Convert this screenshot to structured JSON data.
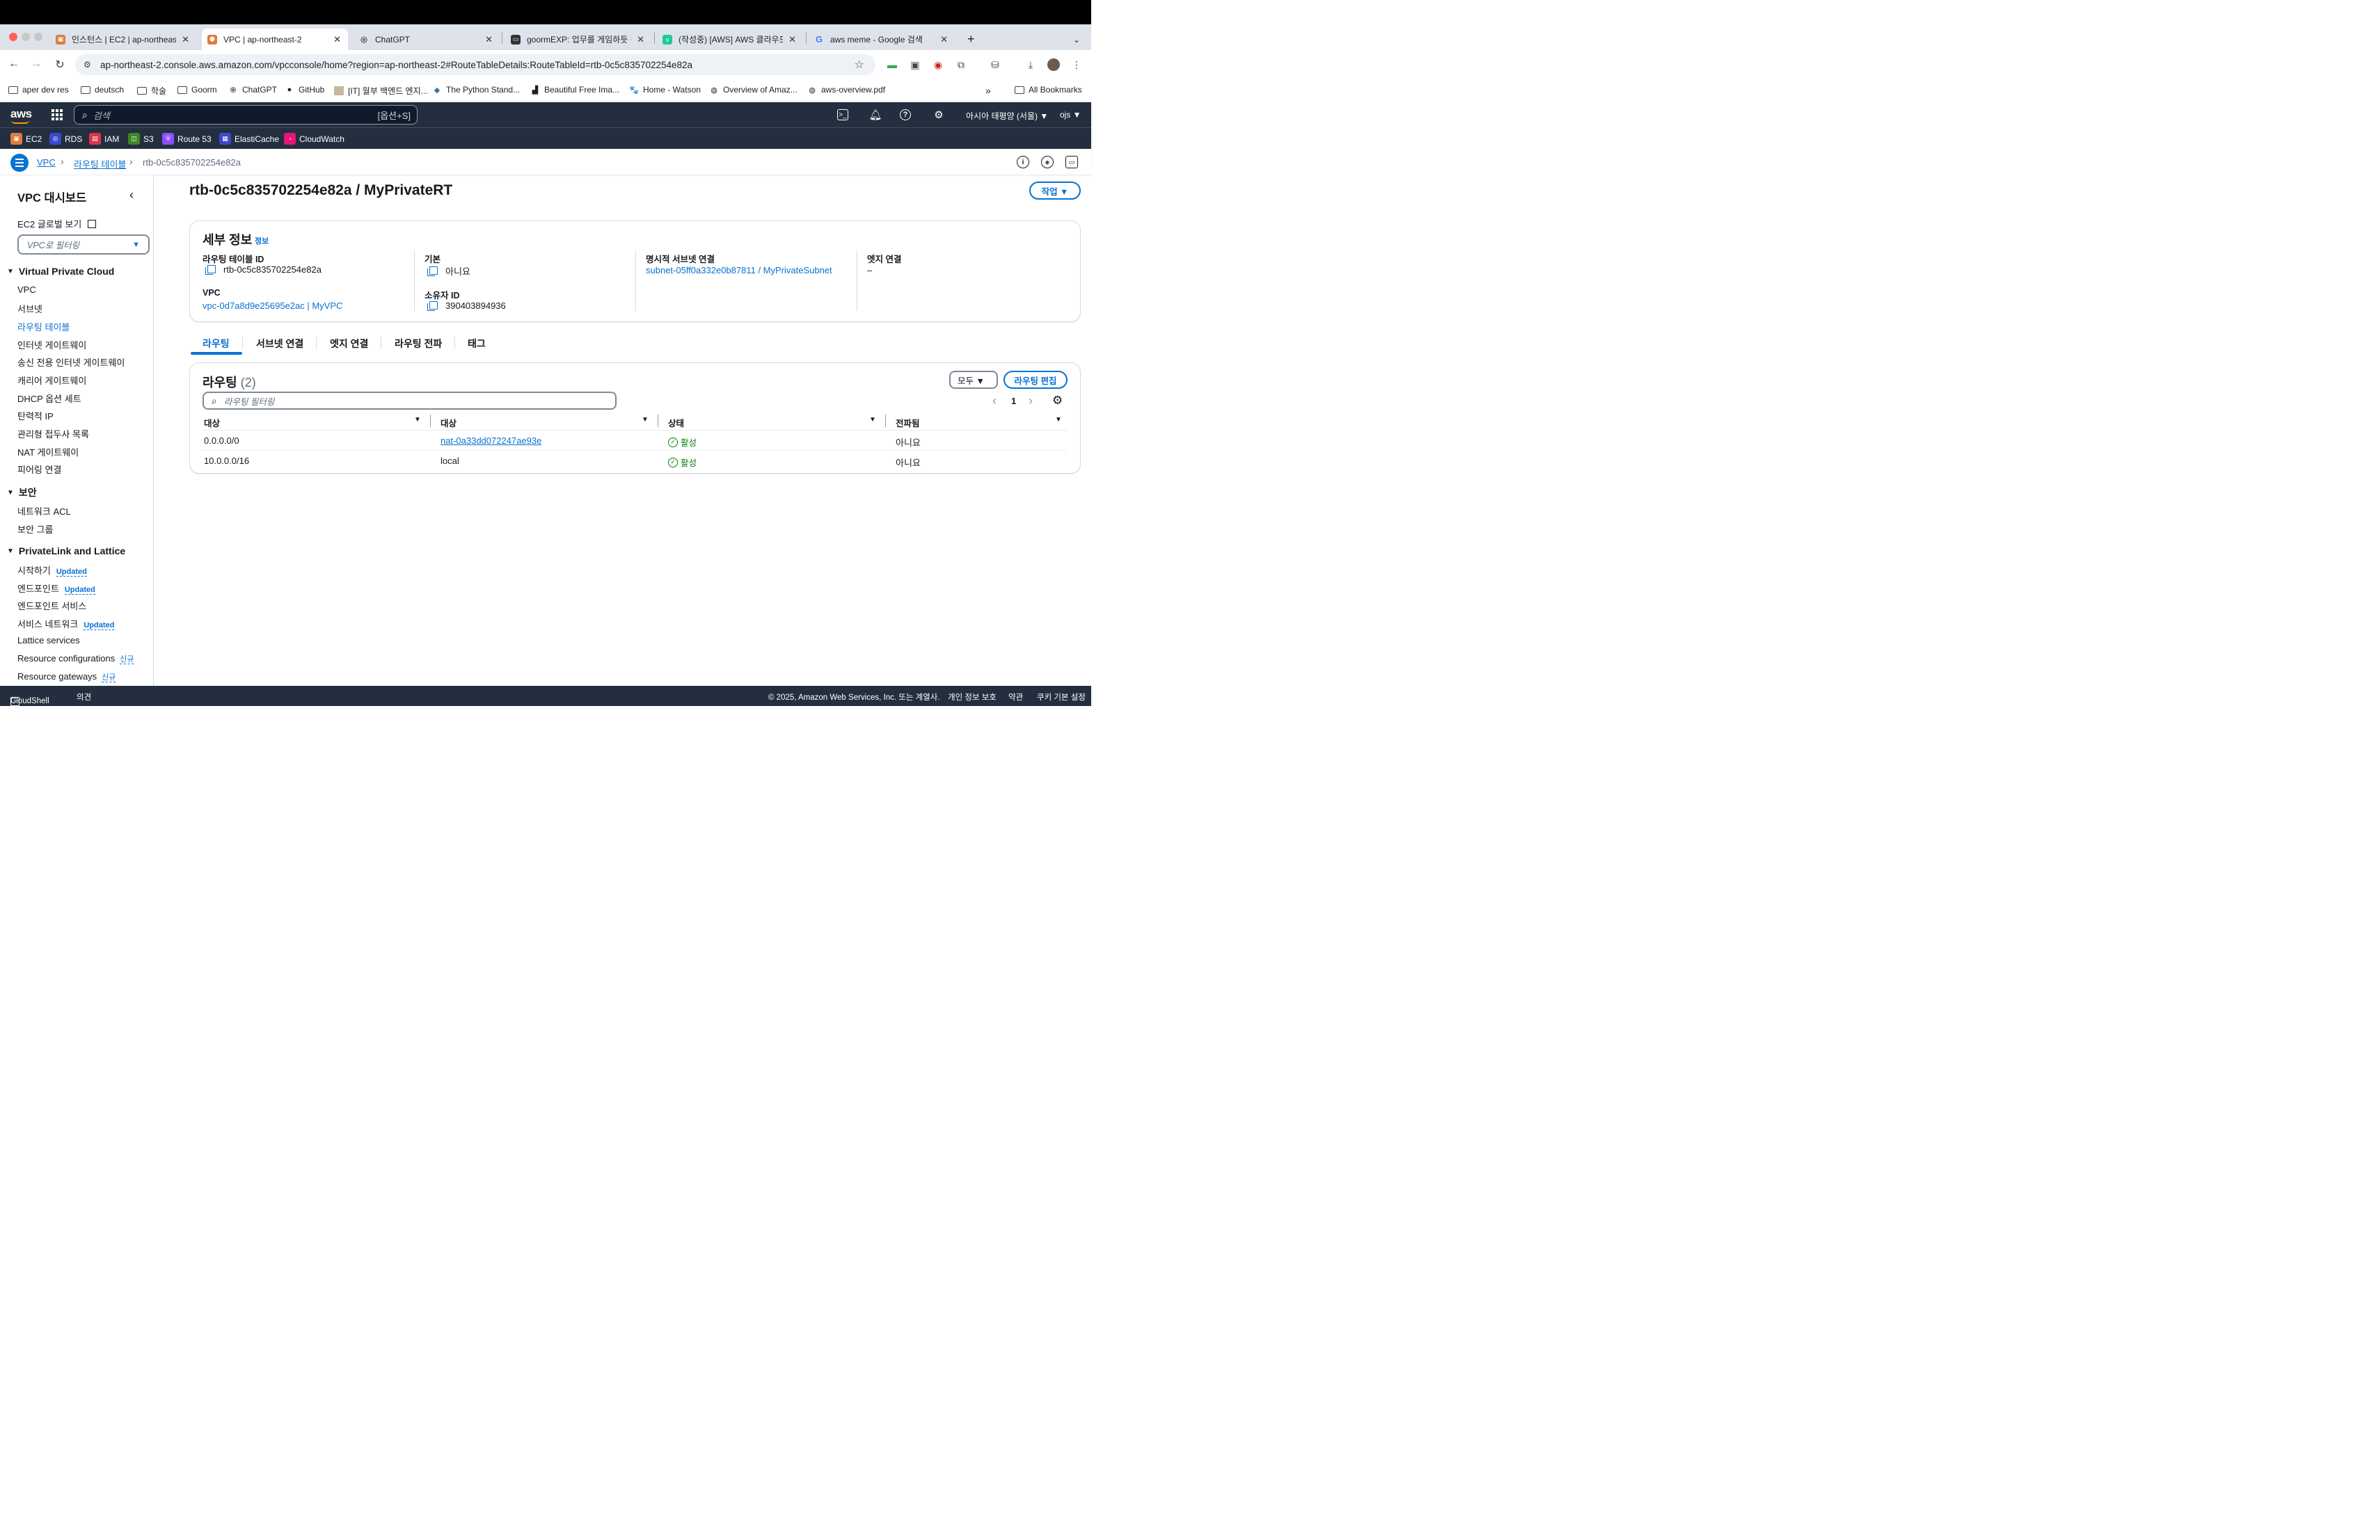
{
  "browser": {
    "tabs": [
      {
        "title": "인스턴스 | EC2 | ap-northeast-2",
        "favicon": "ec2-icon",
        "color": "#e07b39"
      },
      {
        "title": "VPC | ap-northeast-2",
        "favicon": "vpc-icon",
        "color": "#e07b39"
      },
      {
        "title": "ChatGPT",
        "favicon": "chatgpt-icon",
        "color": "#444444"
      },
      {
        "title": "goormEXP: 업무를 게임하듯 관리",
        "favicon": "goorm-icon",
        "color": "#333333"
      },
      {
        "title": "(작성중) [AWS] AWS 클라우드 네",
        "favicon": "velog-icon",
        "color": "#20c997"
      },
      {
        "title": "aws meme - Google 검색",
        "favicon": "google-icon",
        "color": "#4285f4"
      }
    ],
    "new_tab": "+",
    "url": "ap-northeast-2.console.aws.amazon.com/vpcconsole/home?region=ap-northeast-2#RouteTableDetails:RouteTableId=rtb-0c5c835702254e82a",
    "bookmarks": [
      {
        "label": "aper dev res",
        "icon": "folder-icon"
      },
      {
        "label": "deutsch",
        "icon": "folder-icon"
      },
      {
        "label": "학술",
        "icon": "folder-icon"
      },
      {
        "label": "Goorm",
        "icon": "folder-icon"
      },
      {
        "label": "ChatGPT",
        "icon": "chatgpt-icon"
      },
      {
        "label": "GitHub",
        "icon": "github-icon"
      },
      {
        "label": "[IT] 월부 백엔드 엔지...",
        "icon": "page-icon"
      },
      {
        "label": "The Python Stand...",
        "icon": "python-icon"
      },
      {
        "label": "Beautiful Free Ima...",
        "icon": "unsplash-icon"
      },
      {
        "label": "Home - Watson",
        "icon": "watson-icon"
      },
      {
        "label": "Overview of Amaz...",
        "icon": "globe-icon"
      },
      {
        "label": "aws-overview.pdf",
        "icon": "globe-icon"
      }
    ],
    "more_bookmarks": "»",
    "all_bookmarks": "All Bookmarks"
  },
  "aws": {
    "logo": "aws",
    "search_placeholder": "검색",
    "search_shortcut": "[옵션+S]",
    "region": "아시아 태평양 (서울) ▼",
    "user": "ojs ▼",
    "services": [
      {
        "label": "EC2",
        "color": "#e07b39"
      },
      {
        "label": "RDS",
        "color": "#3b48cc"
      },
      {
        "label": "IAM",
        "color": "#dd344c"
      },
      {
        "label": "S3",
        "color": "#3f8624"
      },
      {
        "label": "Route 53",
        "color": "#8c4fff"
      },
      {
        "label": "ElastiCache",
        "color": "#3b48cc"
      },
      {
        "label": "CloudWatch",
        "color": "#e7157b"
      }
    ]
  },
  "breadcrumb": {
    "items": [
      "VPC",
      "라우팅 테이블",
      "rtb-0c5c835702254e82a"
    ]
  },
  "sidebar": {
    "title": "VPC 대시보드",
    "ec2_global": "EC2 글로벌 보기",
    "filter_placeholder": "VPC로 필터링",
    "sections": [
      {
        "title": "Virtual Private Cloud",
        "items": [
          "VPC",
          "서브넷",
          "라우팅 테이블",
          "인터넷 게이트웨이",
          "송신 전용 인터넷 게이트웨이",
          "캐리어 게이트웨이",
          "DHCP 옵션 세트",
          "탄력적 IP",
          "관리형 접두사 목록",
          "NAT 게이트웨이",
          "피어링 연결"
        ]
      },
      {
        "title": "보안",
        "items": [
          "네트워크 ACL",
          "보안 그룹"
        ]
      },
      {
        "title": "PrivateLink and Lattice",
        "items": [
          "시작하기",
          "엔드포인트",
          "엔드포인트 서비스",
          "서비스 네트워크",
          "Lattice services",
          "Resource configurations",
          "Resource gateways"
        ]
      }
    ],
    "active_item": "라우팅 테이블",
    "badge_updated": "Updated",
    "badge_new": "신규"
  },
  "main": {
    "title": "rtb-0c5c835702254e82a / MyPrivateRT",
    "actions_button": "작업 ▼",
    "details": {
      "header": "세부 정보",
      "info": "정보",
      "route_table_id_label": "라우팅 테이블 ID",
      "route_table_id": "rtb-0c5c835702254e82a",
      "vpc_label": "VPC",
      "vpc": "vpc-0d7a8d9e25695e2ac | MyVPC",
      "main_label": "기본",
      "main": "아니요",
      "owner_label": "소유자 ID",
      "owner": "390403894936",
      "subnet_assoc_label": "명시적 서브넷 연결",
      "subnet_assoc": "subnet-05ff0a332e0b87811 / MyPrivateSubnet",
      "edge_assoc_label": "엣지 연결",
      "edge_assoc": "–"
    },
    "tabs": [
      "라우팅",
      "서브넷 연결",
      "엣지 연결",
      "라우팅 전파",
      "태그"
    ],
    "routes": {
      "header": "라우팅",
      "count": "(2)",
      "filter_select": "모두 ▼",
      "edit_button": "라우팅 편집",
      "filter_placeholder": "라우팅 필터링",
      "page": "1",
      "columns": [
        "대상",
        "대상",
        "상태",
        "전파됨"
      ],
      "rows": [
        {
          "destination": "0.0.0.0/0",
          "target": "nat-0a33dd072247ae93e",
          "status": "활성",
          "propagated": "아니요"
        },
        {
          "destination": "10.0.0.0/16",
          "target": "local",
          "status": "활성",
          "propagated": "아니요"
        }
      ]
    }
  },
  "footer": {
    "cloudshell": "CloudShell",
    "feedback": "의견",
    "copyright": "© 2025, Amazon Web Services, Inc. 또는 계열사.",
    "privacy": "개인 정보 보호",
    "terms": "약관",
    "cookies": "쿠키 기본 설정"
  }
}
